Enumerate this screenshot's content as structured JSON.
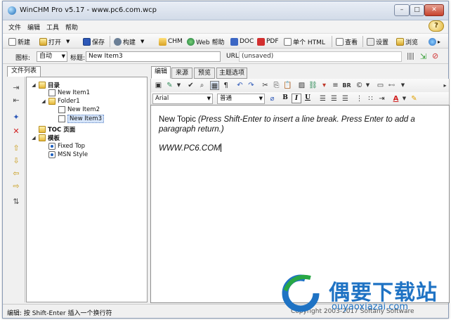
{
  "window": {
    "title": "WinCHM Pro v5.17 - www.pc6.com.wcp",
    "controls": {
      "minimize": "–",
      "maximize": "□",
      "close": "✕"
    }
  },
  "menu": {
    "items": [
      "文件",
      "编辑",
      "工具",
      "帮助"
    ],
    "help_badge": "?"
  },
  "toolbar": {
    "new": "新建",
    "open": "打开",
    "save": "保存",
    "build": "构建",
    "chm": "CHM",
    "web_help": "Web 帮助",
    "doc": "DOC",
    "pdf": "PDF",
    "single_html": "单个 HTML",
    "view": "查看",
    "settings": "设置",
    "browse": "浏览"
  },
  "props": {
    "icon_label": "图标:",
    "icon_value": "自动",
    "title_label": "标题:",
    "title_value": "New Item3",
    "url_label": "URL:",
    "url_value": "(unsaved)"
  },
  "left_panel": {
    "tab": "文件列表",
    "tree": [
      {
        "label": "目录",
        "level": 0,
        "expander": "◢",
        "icon": "folder",
        "bold": true
      },
      {
        "label": "New Item1",
        "level": 1,
        "expander": "",
        "icon": "page",
        "bold": false
      },
      {
        "label": "Folder1",
        "level": 1,
        "expander": "◢",
        "icon": "folder",
        "bold": false
      },
      {
        "label": "New Item2",
        "level": 2,
        "expander": "",
        "icon": "page",
        "bold": false
      },
      {
        "label": "New Item3",
        "level": 2,
        "expander": "",
        "icon": "page",
        "bold": false,
        "selected": true
      },
      {
        "label": "TOC 页面",
        "level": 0,
        "expander": "",
        "icon": "folder",
        "bold": true
      },
      {
        "label": "模板",
        "level": 0,
        "expander": "◢",
        "icon": "folder",
        "bold": true
      },
      {
        "label": "Fixed Top",
        "level": 1,
        "expander": "",
        "icon": "link",
        "bold": false
      },
      {
        "label": "MSN Style",
        "level": 1,
        "expander": "",
        "icon": "link",
        "bold": false
      }
    ]
  },
  "editor": {
    "tabs": [
      "编辑",
      "来源",
      "预览",
      "主题选项"
    ],
    "font": "Arial",
    "style": "普通",
    "bold": "B",
    "italic": "I",
    "underline": "U",
    "text_normal": "New Topic ",
    "text_italic": "(Press Shift-Enter to insert a line break. Press Enter to add a paragraph return.)",
    "url_text": "WWW.PC6.COM"
  },
  "status": {
    "left": "编辑: 按 Shift-Enter 插入一个换行符",
    "right": "Copyright 2003-2017 Softany Software"
  },
  "watermark": {
    "text": "偶要下载站",
    "url": "ouyaoxiazai.com"
  }
}
